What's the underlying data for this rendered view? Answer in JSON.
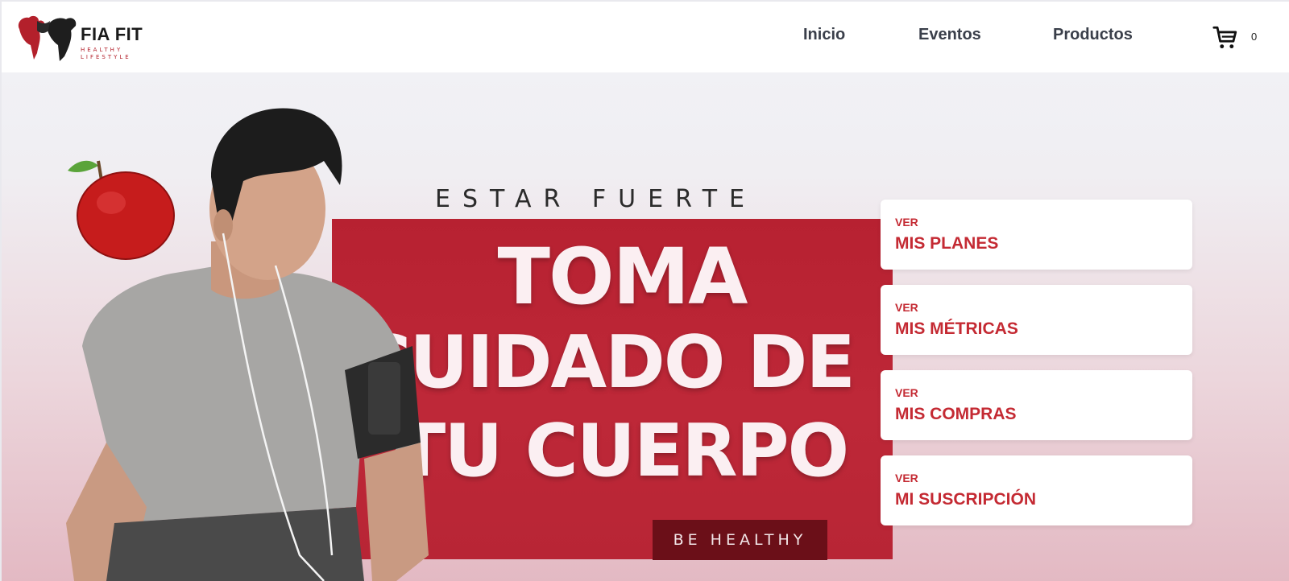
{
  "brand": {
    "name": "FIA FIT",
    "tagline_line1": "HEALTHY",
    "tagline_line2": "LIFESTYLE",
    "accent": "#c42a33"
  },
  "nav": {
    "items": [
      "Inicio",
      "Eventos",
      "Productos"
    ]
  },
  "cart": {
    "icon": "shopping-cart-icon",
    "count": "0"
  },
  "hero": {
    "kicker": "ESTAR FUERTE",
    "headline_line1": "TOMA",
    "headline_line2": "CUIDADO DE",
    "headline_line3": "TU CUERPO",
    "badge": "BE HEALTHY",
    "banner_color": "#b72131"
  },
  "cards": [
    {
      "prefix": "VER",
      "title": "MIS PLANES"
    },
    {
      "prefix": "VER",
      "title": "MIS MÉTRICAS"
    },
    {
      "prefix": "VER",
      "title": "MIS COMPRAS"
    },
    {
      "prefix": "VER",
      "title": "MI SUSCRIPCIÓN"
    }
  ]
}
